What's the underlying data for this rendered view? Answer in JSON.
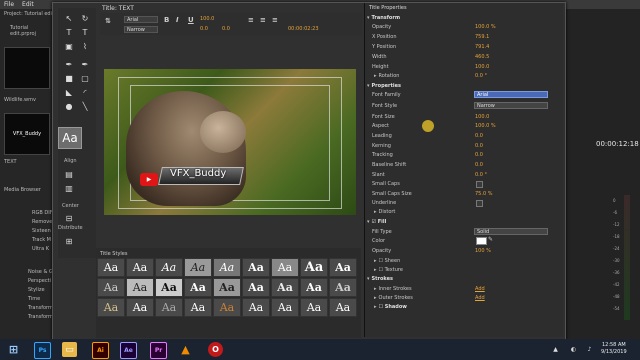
{
  "app": {
    "menu": [
      "File",
      "Edit",
      "Project"
    ],
    "project_title": "Project: Tutorial edi",
    "project_file": "Tutorial edit.prproj",
    "media": [
      "Wildlife.wmv",
      "VFX_Buddy",
      "TEXT"
    ],
    "media_browser": "Media Browser",
    "folders": [
      "RGB DIF",
      "Remove",
      "Sixteen",
      "Track M",
      "Ultra K",
      "Noise & G",
      "Perspecti",
      "Stylize",
      "Time",
      "Transform",
      "Transform"
    ],
    "timecode": "00:00:12:18",
    "meter_labels": [
      "0",
      "-6",
      "-12",
      "-18",
      "-24",
      "-30",
      "-36",
      "-42",
      "-48",
      "-54"
    ]
  },
  "title_window": {
    "tab": "Title: TEXT",
    "font": "Arial",
    "style": "Narrow",
    "size": "100.0",
    "kerning": "0.0",
    "leading": "0.0",
    "timecode": "00:00:02:23",
    "tool_labels": {
      "align": "Align",
      "center": "Center",
      "distribute": "Distribute"
    },
    "sample": "Aa",
    "canvas_text": "VFX_Buddy",
    "styles_tab": "Title Styles",
    "style_swatches": [
      "Aa",
      "Aa",
      "Aa",
      "Aa",
      "Aa",
      "Aa",
      "Aa",
      "Aa",
      "Aa",
      "Aa",
      "Aa",
      "Aa",
      "Aa",
      "Aa",
      "Aa",
      "Aa",
      "Aa",
      "Aa",
      "Aa",
      "Aa",
      "Aa",
      "Aa",
      "Aa",
      "Aa",
      "Aa",
      "Aa",
      "Aa"
    ]
  },
  "properties": {
    "tab": "Title Properties",
    "transform": "Transform",
    "opacity": {
      "label": "Opacity",
      "value": "100.0 %"
    },
    "xpos": {
      "label": "X Position",
      "value": "759.1"
    },
    "ypos": {
      "label": "Y Position",
      "value": "791.4"
    },
    "width": {
      "label": "Width",
      "value": "460.5"
    },
    "height": {
      "label": "Height",
      "value": "100.0"
    },
    "rotation": {
      "label": "Rotation",
      "value": "0.0 °"
    },
    "props_section": "Properties",
    "font_family": {
      "label": "Font Family",
      "value": "Arial"
    },
    "font_style": {
      "label": "Font Style",
      "value": "Narrow"
    },
    "font_size": {
      "label": "Font Size",
      "value": "100.0"
    },
    "aspect": {
      "label": "Aspect",
      "value": "100.0 %"
    },
    "leading": {
      "label": "Leading",
      "value": "0.0"
    },
    "kerning": {
      "label": "Kerning",
      "value": "0.0"
    },
    "tracking": {
      "label": "Tracking",
      "value": "0.0"
    },
    "baseline": {
      "label": "Baseline Shift",
      "value": "0.0"
    },
    "slant": {
      "label": "Slant",
      "value": "0.0 °"
    },
    "small_caps": {
      "label": "Small Caps"
    },
    "small_caps_size": {
      "label": "Small Caps Size",
      "value": "75.0 %"
    },
    "underline": {
      "label": "Underline"
    },
    "distort": "Distort",
    "fill": "Fill",
    "fill_type": {
      "label": "Fill Type",
      "value": "Solid"
    },
    "color": {
      "label": "Color"
    },
    "fill_opacity": {
      "label": "Opacity",
      "value": "100 %"
    },
    "sheen": "Sheen",
    "texture": "Texture",
    "strokes": "Strokes",
    "inner": {
      "label": "Inner Strokes",
      "value": "Add"
    },
    "outer": {
      "label": "Outer Strokes",
      "value": "Add"
    },
    "shadow": "Shadow"
  },
  "taskbar": {
    "time": "12:58 AM",
    "date": "9/13/2019",
    "apps": [
      "Ps",
      "Ai",
      "Ae",
      "Pr"
    ]
  },
  "colors": {
    "accent": "#e5a33b",
    "selection": "#4a6ab8"
  }
}
